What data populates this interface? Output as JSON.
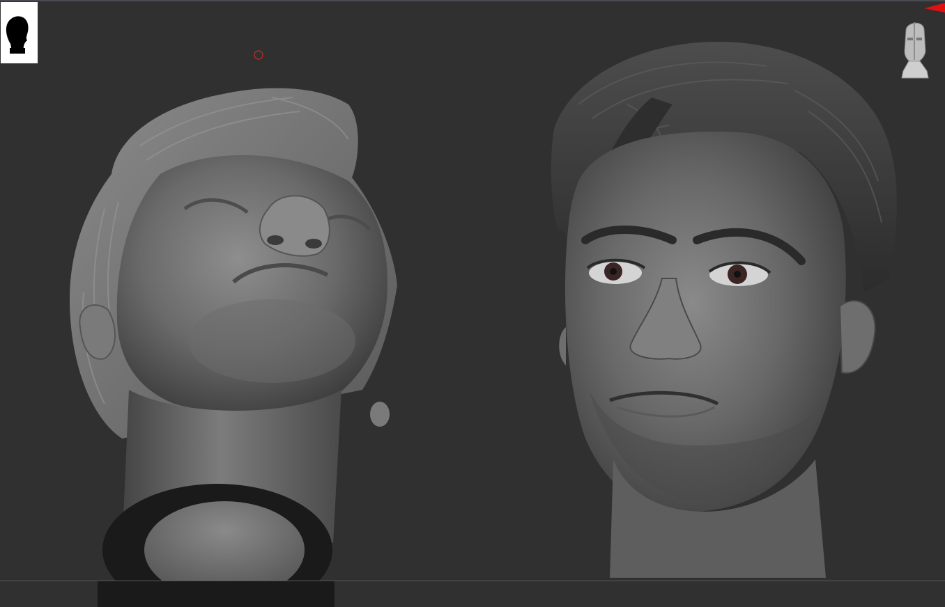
{
  "viewport": {
    "background_color": "#303030",
    "mesh_color": "#7a7a7a"
  },
  "alpha_thumbnail": {
    "icon": "head-silhouette-icon"
  },
  "navigation_gizmo": {
    "icon": "mannequin-head-icon"
  },
  "corner_marker": {
    "icon": "red-triangle-icon",
    "color": "#e01010"
  },
  "cursor": {
    "icon": "brush-cursor-ring-icon",
    "color": "#cc2a2a"
  },
  "models": [
    {
      "name_icon": "head-sculpt-upward-view"
    },
    {
      "name_icon": "head-sculpt-front-view"
    }
  ]
}
